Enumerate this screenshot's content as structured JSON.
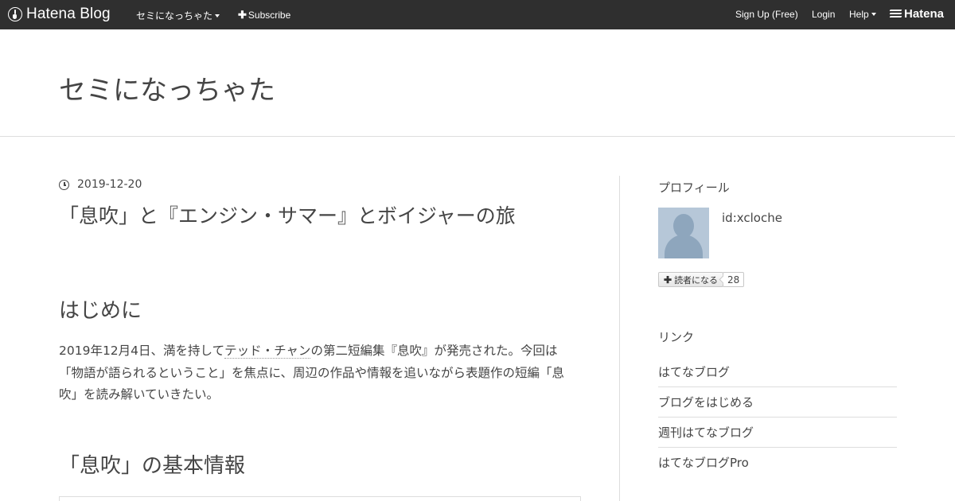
{
  "globalbar": {
    "brand": "Hatena Blog",
    "blog_menu": "セミになっちゃた",
    "subscribe": "Subscribe",
    "signup": "Sign Up (Free)",
    "login": "Login",
    "help": "Help",
    "hatena": "Hatena"
  },
  "blog": {
    "title": "セミになっちゃた"
  },
  "entry": {
    "date": "2019-12-20",
    "title": "「息吹」と『エンジン・サマー』とボイジャーの旅",
    "heading1": "はじめに",
    "para_a": "2019年12月4日、満を持して",
    "para_link": "テッド・チャン",
    "para_b": "の第二短編集『息吹』が発売された。今回は",
    "para_line2": "「物語が語られるということ」を焦点に、周辺の作品や情報を追いながら表題作の短編「息",
    "para_line3": "吹」を読み解いていきたい。",
    "heading2": "「息吹」の基本情報"
  },
  "sidebar": {
    "profile_heading": "プロフィール",
    "user_id": "id:xcloche",
    "subscribe_label": "読者になる",
    "subscriber_count": "28",
    "links_heading": "リンク",
    "links": [
      {
        "label": "はてなブログ"
      },
      {
        "label": "ブログをはじめる"
      },
      {
        "label": "週刊はてなブログ"
      },
      {
        "label": "はてなブログPro"
      }
    ]
  }
}
